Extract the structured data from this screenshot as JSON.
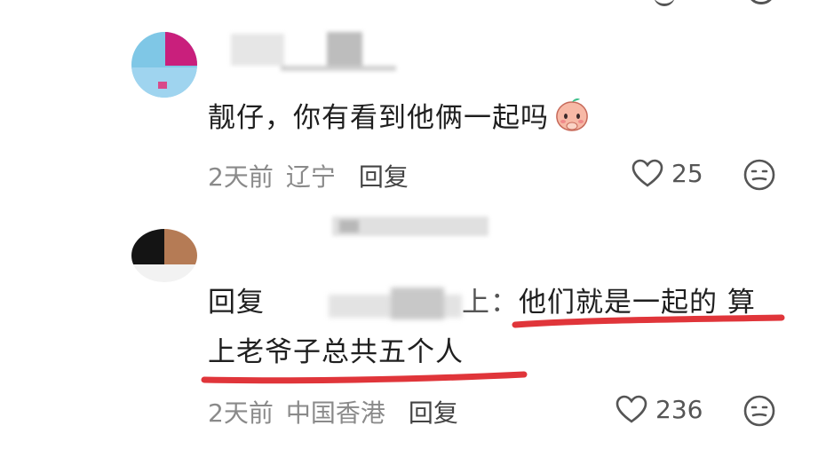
{
  "comments": [
    {
      "text": "靓仔，你有看到他俩一起吗",
      "emoji_icon": "peach-blush-emoji-icon",
      "time": "2天前",
      "location": "辽宁",
      "reply_label": "回复",
      "likes": "25"
    },
    {
      "reply_prefix": "回复",
      "reply_to_suffix": "上：",
      "text_line1": "他们就是一起的 算",
      "text_line2": "上老爷子总共五个人",
      "time": "2天前",
      "location": "中国香港",
      "reply_label": "回复",
      "likes": "236"
    }
  ],
  "icons": {
    "like": "heart-outline-icon",
    "emoji": "smiley-face-icon"
  },
  "colors": {
    "underline": "#e0353a",
    "meta": "#8a8a8a",
    "text": "#1f1f1f"
  }
}
